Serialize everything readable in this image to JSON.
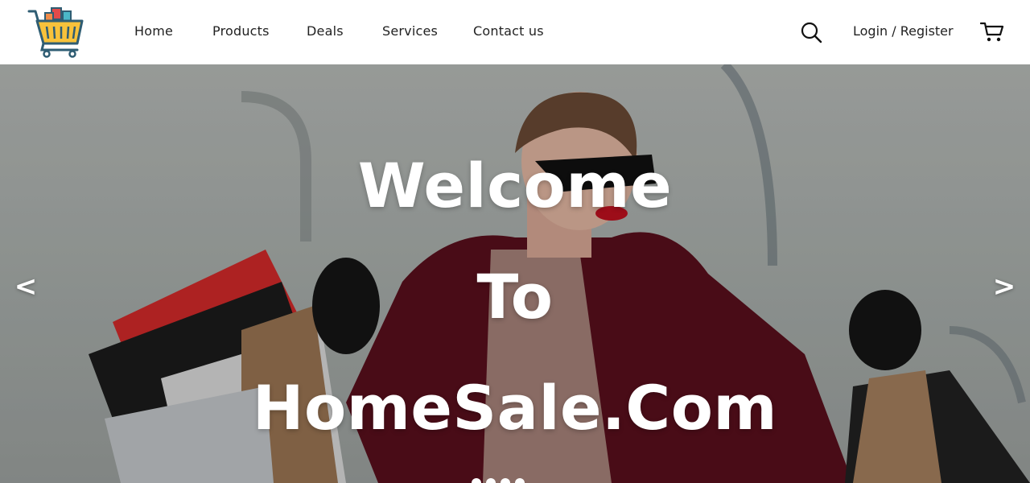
{
  "header": {
    "logo_icon": "shopping-cart-logo",
    "nav": {
      "home": "Home",
      "products": "Products",
      "deals": "Deals",
      "services": "Services",
      "contact": "Contact us"
    },
    "search_icon": "search-icon",
    "login_label": "Login / Register",
    "cart_icon": "cart-icon"
  },
  "hero": {
    "title_line1": "Welcome",
    "title_line2": "To",
    "title_line3": "HomeSale.Com",
    "prev_label": "<",
    "next_label": ">",
    "slide_count": 4,
    "active_slide": 1
  },
  "colors": {
    "nav_text": "#222222",
    "hero_text": "#ffffff",
    "logo_yellow": "#f7c23b",
    "logo_blue": "#2f5d73",
    "logo_red": "#e24a4a",
    "logo_teal": "#4bb8c8"
  }
}
